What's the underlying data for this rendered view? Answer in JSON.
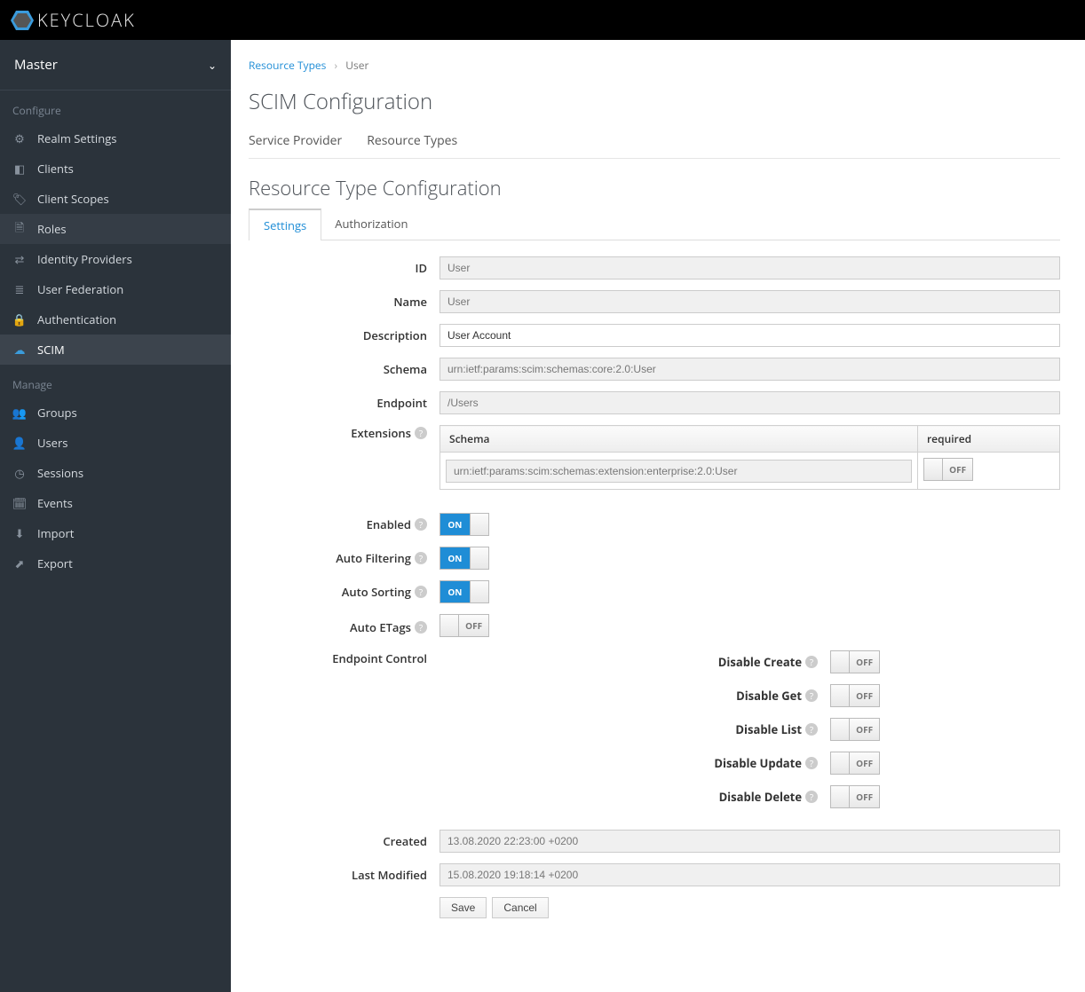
{
  "brand": "KEYCLOAK",
  "realm": "Master",
  "sidebar": {
    "configure_label": "Configure",
    "manage_label": "Manage",
    "configure": [
      {
        "label": "Realm Settings",
        "icon": "sliders-icon"
      },
      {
        "label": "Clients",
        "icon": "cube-icon"
      },
      {
        "label": "Client Scopes",
        "icon": "tags-icon"
      },
      {
        "label": "Roles",
        "icon": "file-icon"
      },
      {
        "label": "Identity Providers",
        "icon": "exchange-icon"
      },
      {
        "label": "User Federation",
        "icon": "database-icon"
      },
      {
        "label": "Authentication",
        "icon": "lock-icon"
      },
      {
        "label": "SCIM",
        "icon": "cloud-icon"
      }
    ],
    "manage": [
      {
        "label": "Groups",
        "icon": "group-icon"
      },
      {
        "label": "Users",
        "icon": "user-icon"
      },
      {
        "label": "Sessions",
        "icon": "clock-icon"
      },
      {
        "label": "Events",
        "icon": "calendar-icon"
      },
      {
        "label": "Import",
        "icon": "import-icon"
      },
      {
        "label": "Export",
        "icon": "export-icon"
      }
    ]
  },
  "breadcrumb": {
    "root": "Resource Types",
    "current": "User"
  },
  "page_title": "SCIM Configuration",
  "subtabs": [
    "Service Provider",
    "Resource Types"
  ],
  "section_title": "Resource Type Configuration",
  "tabs": [
    "Settings",
    "Authorization"
  ],
  "labels": {
    "id": "ID",
    "name": "Name",
    "description": "Description",
    "schema": "Schema",
    "endpoint": "Endpoint",
    "extensions": "Extensions",
    "enabled": "Enabled",
    "auto_filtering": "Auto Filtering",
    "auto_sorting": "Auto Sorting",
    "auto_etags": "Auto ETags",
    "endpoint_control": "Endpoint Control",
    "disable_create": "Disable Create",
    "disable_get": "Disable Get",
    "disable_list": "Disable List",
    "disable_update": "Disable Update",
    "disable_delete": "Disable Delete",
    "created": "Created",
    "last_modified": "Last Modified",
    "save": "Save",
    "cancel": "Cancel",
    "ext_schema": "Schema",
    "ext_required": "required",
    "on": "ON",
    "off": "OFF"
  },
  "values": {
    "id": "User",
    "name": "User",
    "description": "User Account",
    "schema": "urn:ietf:params:scim:schemas:core:2.0:User",
    "endpoint": "/Users",
    "ext_schema": "urn:ietf:params:scim:schemas:extension:enterprise:2.0:User",
    "created": "13.08.2020 22:23:00 +0200",
    "last_modified": "15.08.2020 19:18:14 +0200"
  },
  "toggles": {
    "ext_required": false,
    "enabled": true,
    "auto_filtering": true,
    "auto_sorting": true,
    "auto_etags": false,
    "disable_create": false,
    "disable_get": false,
    "disable_list": false,
    "disable_update": false,
    "disable_delete": false
  }
}
